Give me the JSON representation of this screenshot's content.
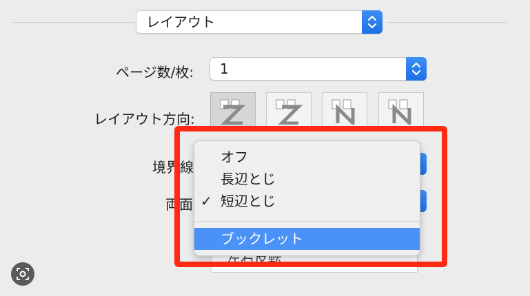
{
  "section_popup": {
    "value": "レイアウト"
  },
  "pages_per_sheet": {
    "label": "ページ数/枚:",
    "value": "1"
  },
  "layout_direction": {
    "label": "レイアウト方向:",
    "options": [
      {
        "name": "Z",
        "icon": "layout-z-icon",
        "selected": true
      },
      {
        "name": "reverse-Z",
        "icon": "layout-reverse-z-icon",
        "selected": false
      },
      {
        "name": "N-reverse",
        "icon": "layout-reverse-n-icon",
        "selected": false
      },
      {
        "name": "N",
        "icon": "layout-n-icon",
        "selected": false
      }
    ]
  },
  "border": {
    "label": "境界線"
  },
  "two_sided": {
    "label": "両面",
    "menu": {
      "items": [
        {
          "label": "オフ",
          "checked": false
        },
        {
          "label": "長辺とじ",
          "checked": false
        },
        {
          "label": "短辺とじ",
          "checked": true
        },
        {
          "label": "ブックレット",
          "highlighted": true
        }
      ],
      "check_glyph": "✓"
    }
  },
  "hidden_field": {
    "partial_text": "左右反転"
  },
  "accent_color": "#1f6fe6",
  "annotation_color": "#ff2a14"
}
